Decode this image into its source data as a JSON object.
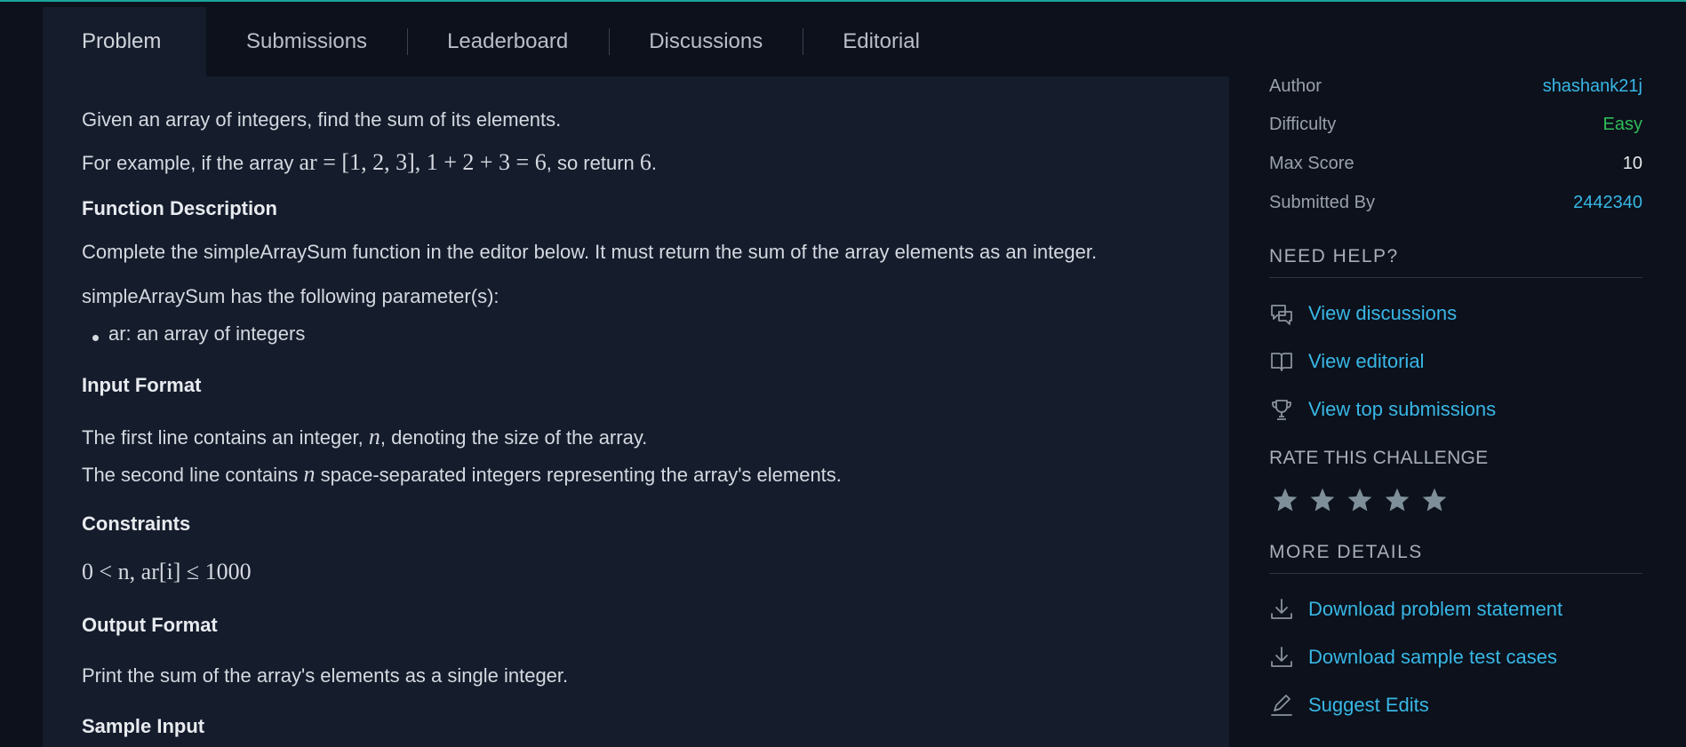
{
  "tabs": [
    {
      "label": "Problem"
    },
    {
      "label": "Submissions"
    },
    {
      "label": "Leaderboard"
    },
    {
      "label": "Discussions"
    },
    {
      "label": "Editorial"
    }
  ],
  "problem": {
    "intro": "Given an array of integers, find the sum of its elements.",
    "example_prefix": "For example, if the array ",
    "example_math_1": "ar = [1, 2, 3], 1 + 2 + 3 = 6",
    "example_mid": ", so return ",
    "example_math_2": "6",
    "example_suffix": ".",
    "function_description_heading": "Function Description",
    "function_description": "Complete the simpleArraySum function in the editor below. It must return the sum of the array elements as an integer.",
    "parameters_intro": "simpleArraySum has the following parameter(s):",
    "parameters": [
      "ar: an array of integers"
    ],
    "input_format_heading": "Input Format",
    "input_line_1_prefix": "The first line contains an integer, ",
    "input_line_1_var": "n",
    "input_line_1_suffix": ", denoting the size of the array.",
    "input_line_2_prefix": "The second line contains ",
    "input_line_2_var": "n",
    "input_line_2_suffix": " space-separated integers representing the array's elements.",
    "constraints_heading": "Constraints",
    "constraints_math": "0 < n, ar[i] ≤ 1000",
    "output_format_heading": "Output Format",
    "output_format": "Print the sum of the array's elements as a single integer.",
    "sample_input_heading": "Sample Input"
  },
  "meta": {
    "author_label": "Author",
    "author_value": "shashank21j",
    "difficulty_label": "Difficulty",
    "difficulty_value": "Easy",
    "max_score_label": "Max Score",
    "max_score_value": "10",
    "submitted_by_label": "Submitted By",
    "submitted_by_value": "2442340"
  },
  "help": {
    "title": "NEED HELP?",
    "links": [
      {
        "label": "View discussions",
        "icon": "discussion-icon"
      },
      {
        "label": "View editorial",
        "icon": "book-icon"
      },
      {
        "label": "View top submissions",
        "icon": "trophy-icon"
      }
    ]
  },
  "rating": {
    "title": "RATE THIS CHALLENGE",
    "stars_total": 5,
    "stars_filled": 0
  },
  "details": {
    "title": "MORE DETAILS",
    "links": [
      {
        "label": "Download problem statement",
        "icon": "download-icon"
      },
      {
        "label": "Download sample test cases",
        "icon": "download-icon"
      },
      {
        "label": "Suggest Edits",
        "icon": "pencil-icon"
      }
    ]
  },
  "colors": {
    "background": "#0c111b",
    "panel": "#151c2c",
    "link": "#38b7e6",
    "easy": "#2ebd59",
    "accent": "#1aa59a",
    "star": "#7e8f99"
  }
}
